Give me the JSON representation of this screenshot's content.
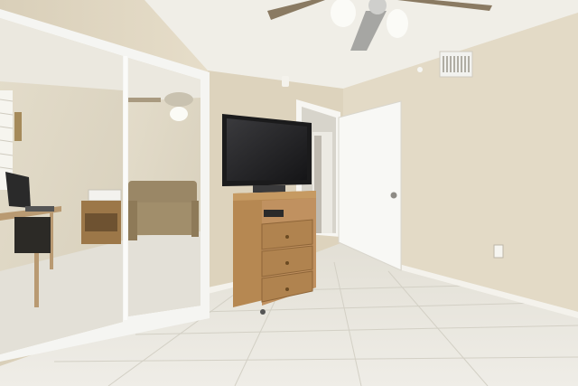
{
  "scene": {
    "description_tags": [
      "bedroom",
      "mirrored-closet",
      "ceiling-fan",
      "tv",
      "wicker-cabinet",
      "open-door",
      "tile-floor"
    ],
    "colors": {
      "wall": "#e3dac6",
      "wall_shadow": "#d2c8b2",
      "ceiling": "#f1efe8",
      "floor": "#e6e4dc",
      "floor_grout": "#d4d1c6",
      "baseboard": "#f4f2ec",
      "door": "#f7f7f4",
      "tv_frame": "#1a1a1a",
      "tv_screen": "#2a2a2c",
      "wicker": "#b98b55",
      "wicker_dark": "#8e6538",
      "mirror_frame": "#f5f5f2",
      "sofa": "#9a8766"
    }
  }
}
